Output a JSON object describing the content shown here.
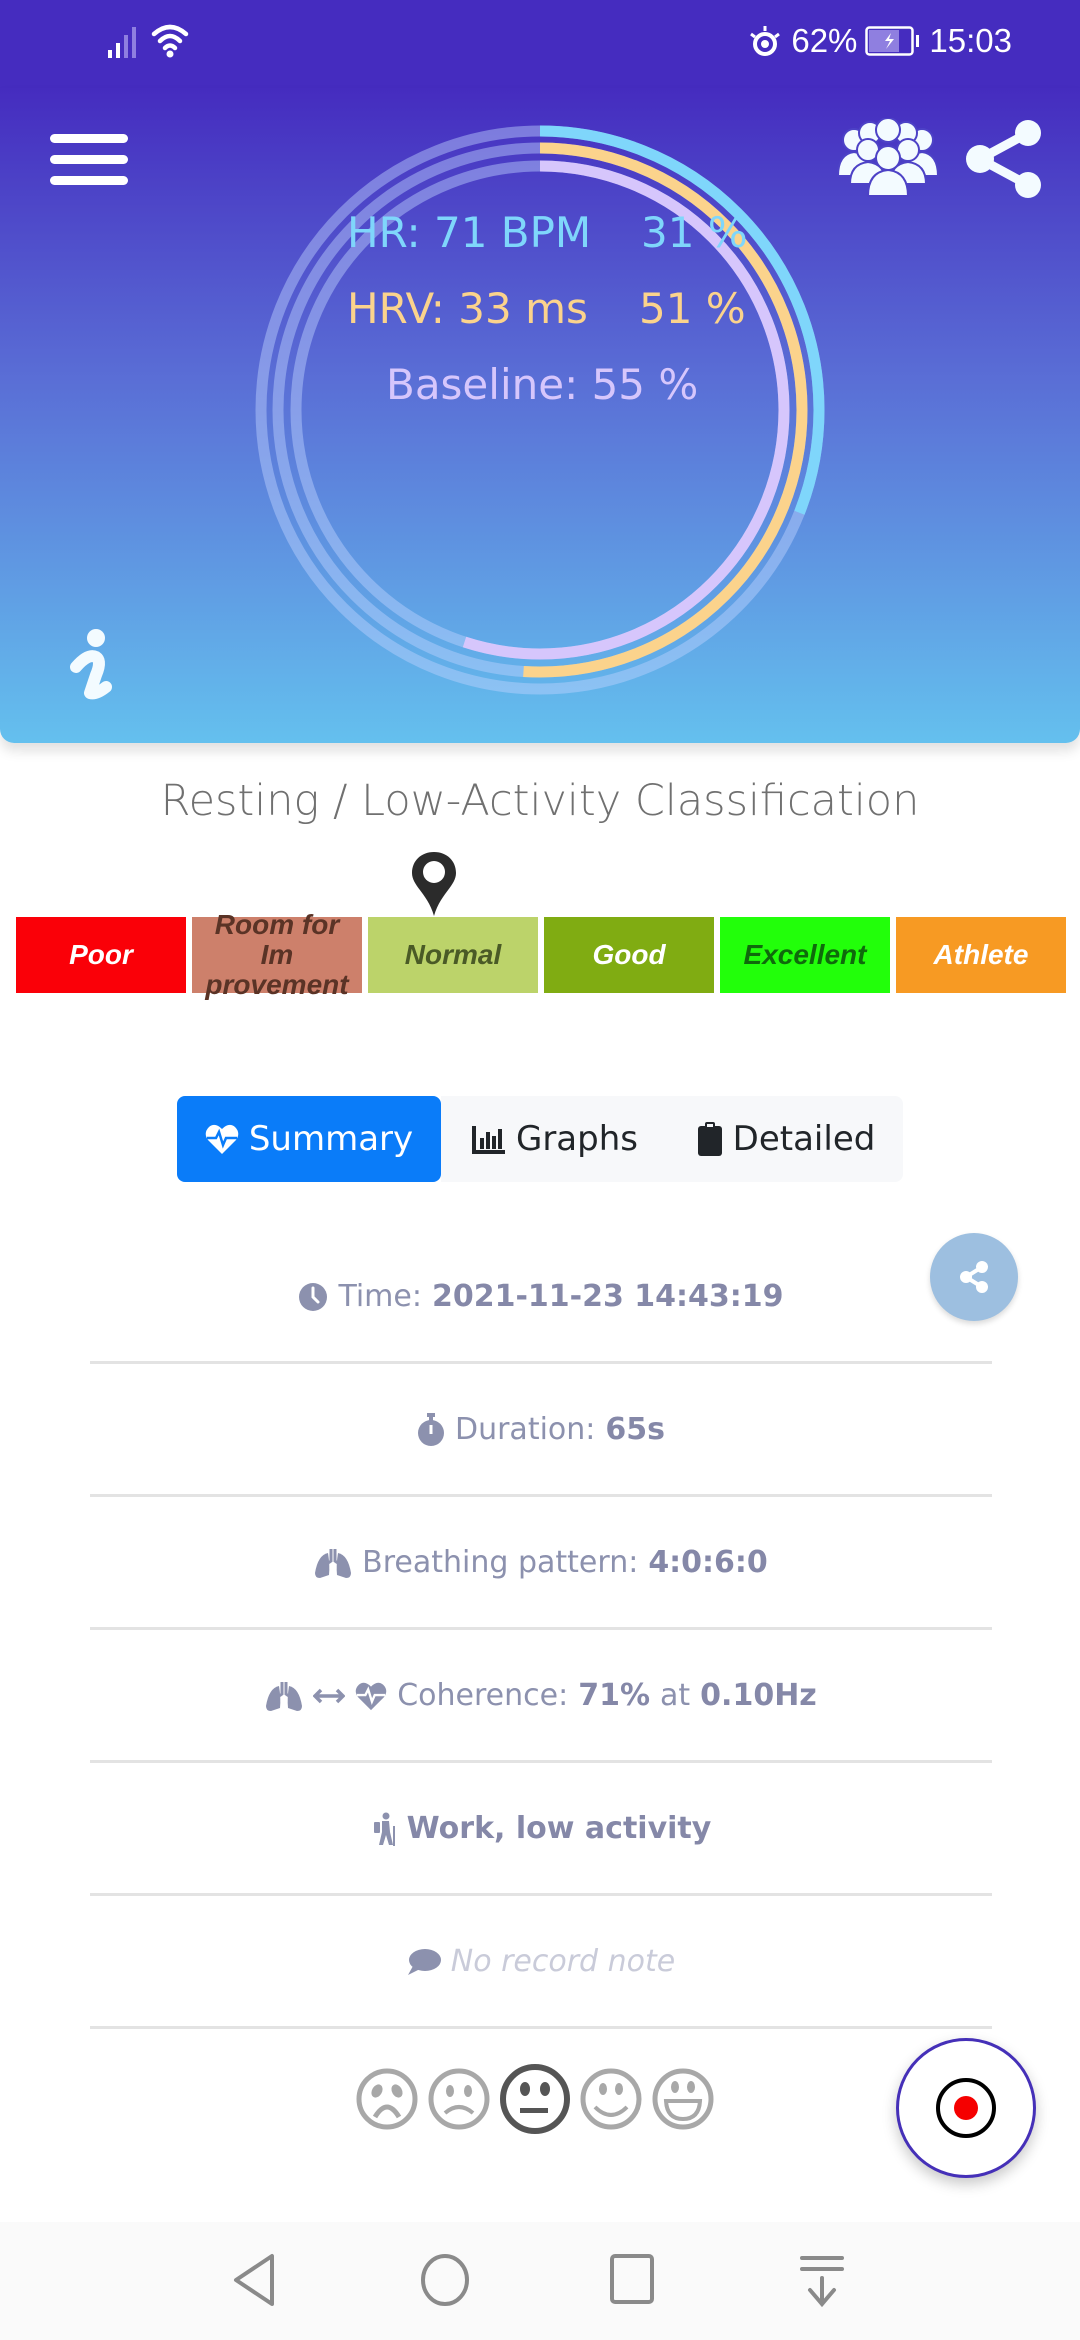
{
  "status_bar": {
    "battery_percent": "62%",
    "time": "15:03",
    "icons": [
      "signal-icon",
      "wifi-icon",
      "eye-comfort-icon",
      "battery-charging-icon"
    ]
  },
  "header": {
    "menu_icon": "hamburger-menu-icon",
    "group_icon": "group-users-icon",
    "share_icon": "share-icon",
    "info_icon": "info-icon",
    "gauge": {
      "hr_label": "HR: 71 BPM",
      "hr_percent_label": "31 %",
      "hr_percent": 31,
      "hrv_label": "HRV: 33 ms",
      "hrv_percent_label": "51 %",
      "hrv_percent": 51,
      "baseline_label": "Baseline: 55 %",
      "baseline_percent": 55,
      "colors": {
        "hr": "#7fd6fb",
        "hrv": "#fbd38c",
        "baseline": "#d6c6fc"
      }
    }
  },
  "classification": {
    "title": "Resting / Low-Activity Classification",
    "selected_index": 2,
    "levels": [
      {
        "label": "Poor",
        "bg": "#fa0008",
        "fg": "#ffffff"
      },
      {
        "label": "Room for Im provement",
        "bg": "#cd806b",
        "fg": "#5a3326"
      },
      {
        "label": "Normal",
        "bg": "#bcd36a",
        "fg": "#4a5a26"
      },
      {
        "label": "Good",
        "bg": "#80ac12",
        "fg": "#ffffff"
      },
      {
        "label": "Excellent",
        "bg": "#22ff0a",
        "fg": "#0f6a0c"
      },
      {
        "label": "Athlete",
        "bg": "#f79a23",
        "fg": "#ffffff"
      }
    ]
  },
  "tabs": [
    {
      "label": "Summary",
      "icon": "heartbeat-icon",
      "active": true
    },
    {
      "label": "Graphs",
      "icon": "bar-chart-icon",
      "active": false
    },
    {
      "label": "Detailed",
      "icon": "clipboard-icon",
      "active": false
    }
  ],
  "summary": {
    "time_label": "Time:",
    "time_value": "2021-11-23 14:43:19",
    "duration_label": "Duration:",
    "duration_value": "65s",
    "breathing_label": "Breathing pattern:",
    "breathing_value": "4:0:6:0",
    "coherence_label": "Coherence:",
    "coherence_value": "71%",
    "coherence_at": "at",
    "coherence_freq": "0.10Hz",
    "activity": "Work, low activity",
    "note": "No record note"
  },
  "mood": {
    "options": [
      "very-sad",
      "sad",
      "neutral",
      "happy",
      "very-happy"
    ],
    "selected_index": 2
  },
  "record_button_icon": "record-icon",
  "nav": [
    "back-icon",
    "home-icon",
    "recents-icon",
    "notification-pull-icon"
  ]
}
